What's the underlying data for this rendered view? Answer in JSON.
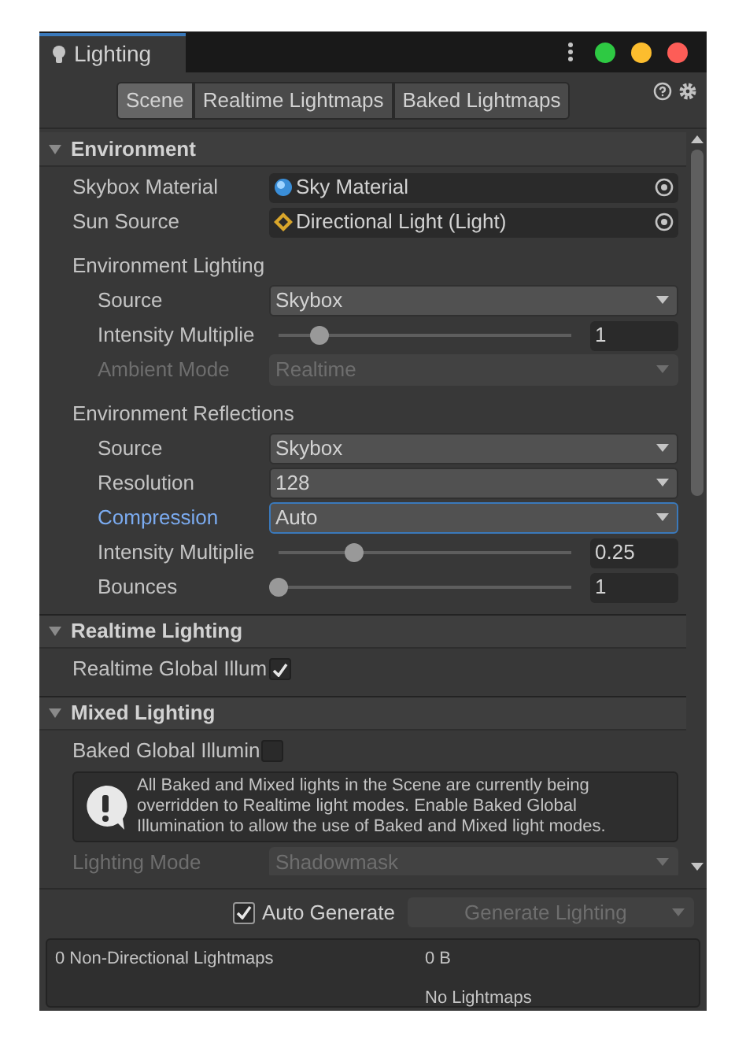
{
  "window": {
    "title": "Lighting"
  },
  "tabs": [
    {
      "label": "Scene",
      "selected": true
    },
    {
      "label": "Realtime Lightmaps",
      "selected": false
    },
    {
      "label": "Baked Lightmaps",
      "selected": false
    }
  ],
  "sections": [
    {
      "title": "Environment",
      "expanded": true,
      "rows": [
        {
          "kind": "material",
          "label": "Skybox Material",
          "value": "Sky Material"
        },
        {
          "kind": "light",
          "label": "Sun Source",
          "value": "Directional Light (Light)"
        },
        {
          "kind": "group",
          "label": "Environment Lighting",
          "children": [
            {
              "kind": "dropdown",
              "label": "Source",
              "value": "Skybox",
              "disabled": false,
              "focused": false
            },
            {
              "kind": "slider",
              "label": "Intensity Multiplie",
              "level": 0.14,
              "reading": "1"
            },
            {
              "kind": "dropdown",
              "label": "Ambient Mode",
              "value": "Realtime",
              "disabled": true,
              "focused": false
            }
          ]
        },
        {
          "kind": "group",
          "label": "Environment Reflections",
          "children": [
            {
              "kind": "dropdown",
              "label": "Source",
              "value": "Skybox",
              "disabled": false,
              "focused": false
            },
            {
              "kind": "dropdown",
              "label": "Resolution",
              "value": "128",
              "disabled": false,
              "focused": false
            },
            {
              "kind": "dropdown",
              "label": "Compression",
              "value": "Auto",
              "disabled": false,
              "focused": true
            },
            {
              "kind": "slider",
              "label": "Intensity Multiplie",
              "level": 0.26,
              "reading": "0.25"
            },
            {
              "kind": "slider",
              "label": "Bounces",
              "level": 0,
              "reading": "1"
            }
          ]
        }
      ]
    },
    {
      "title": "Realtime Lighting",
      "expanded": true,
      "rows": [
        {
          "kind": "checkbox",
          "label": "Realtime Global Illum",
          "checked": true
        }
      ]
    },
    {
      "title": "Mixed Lighting",
      "expanded": true,
      "rows": [
        {
          "kind": "checkbox",
          "label": "Baked Global Illumin",
          "checked": false
        },
        {
          "kind": "help",
          "text": "All Baked and Mixed lights in the Scene are currently being overridden to Realtime light modes. Enable Baked Global Illumination to allow the use of Baked and Mixed light modes."
        },
        {
          "kind": "dropdown",
          "label": "Lighting Mode",
          "value": "Shadowmask",
          "disabled": true,
          "focused": false
        }
      ]
    }
  ],
  "auto_generate": {
    "label": "Auto Generate",
    "checked": true
  },
  "generate_button": {
    "label": "Generate Lighting",
    "disabled": true
  },
  "stats": {
    "label": "0 Non-Directional Lightmaps",
    "size": "0 B",
    "status": "No Lightmaps"
  }
}
